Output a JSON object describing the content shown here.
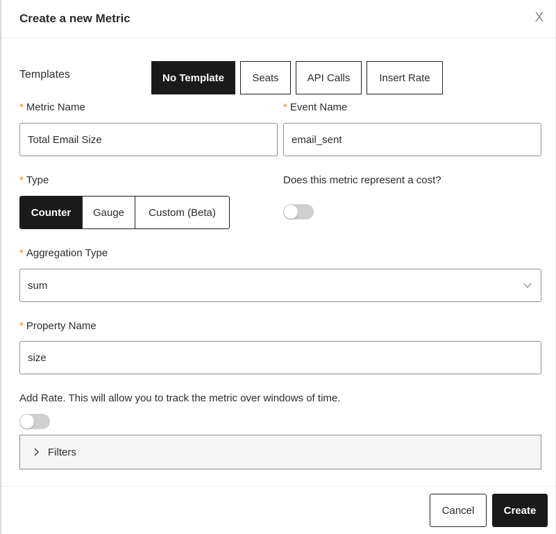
{
  "dialog": {
    "title": "Create a new Metric",
    "close_label": "X"
  },
  "templates": {
    "label": "Templates",
    "options": [
      "No Template",
      "Seats",
      "API Calls",
      "Insert Rate"
    ],
    "selected": "No Template"
  },
  "metric_name": {
    "required_mark": "*",
    "label": "Metric Name",
    "value": "Total Email Size"
  },
  "event_name": {
    "required_mark": "*",
    "label": "Event Name",
    "value": "email_sent"
  },
  "type": {
    "required_mark": "*",
    "label": "Type",
    "options": [
      "Counter",
      "Gauge",
      "Custom (Beta)"
    ],
    "selected": "Counter"
  },
  "cost": {
    "label": "Does this metric represent a cost?",
    "enabled": false
  },
  "aggregation": {
    "required_mark": "*",
    "label": "Aggregation Type",
    "value": "sum"
  },
  "property_name": {
    "required_mark": "*",
    "label": "Property Name",
    "value": "size"
  },
  "rate": {
    "label": "Add Rate. This will allow you to track the metric over windows of time.",
    "enabled": false
  },
  "filters": {
    "label": "Filters"
  },
  "footer": {
    "cancel_label": "Cancel",
    "create_label": "Create"
  },
  "colors": {
    "accent": "#1a1a1a",
    "required": "#e08a1e",
    "toggle_off": "#cfcfcf"
  }
}
